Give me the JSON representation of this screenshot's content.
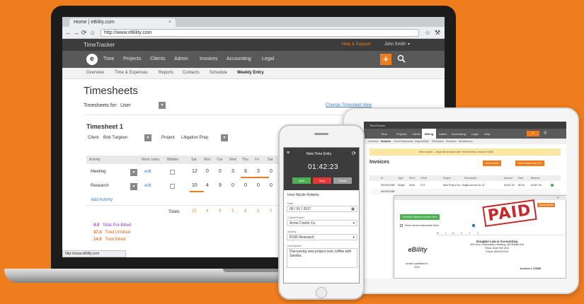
{
  "browser": {
    "tab_title": "Home | eBility.com",
    "url": "http://www.eBility.com",
    "status_url": "http://www.eBility.com"
  },
  "app": {
    "name": "TimeTracker",
    "help_link": "Help & Support",
    "user_name": "John Smith",
    "logo_letter": "e",
    "nav": [
      "Time",
      "Projects",
      "Clients",
      "Admin",
      "Invoices",
      "Accounting",
      "Legal"
    ],
    "subnav": [
      "Overview",
      "Time & Expenses",
      "Reports",
      "Contacts",
      "Schedule",
      "Weekly Entry"
    ],
    "add_icon": "plus-icon",
    "search_icon": "search-icon"
  },
  "timesheets": {
    "page_title": "Timesheets",
    "for_label": "Timesheets for:",
    "for_value": "User",
    "change_link": "Change Timesheet View",
    "sheet_title": "Timesheet 1",
    "client_label": "Client",
    "client_value": "Bob Turgeon",
    "project_label": "Project",
    "project_value": "Litigation Prep",
    "columns": [
      "Activity",
      "",
      "Work notes",
      "Billable",
      "Sat",
      "Mon",
      "Tue",
      "Wed",
      "Thu",
      "Fri",
      "Sat"
    ],
    "rows": [
      {
        "activity": "Meeting",
        "notes": "edit",
        "values": [
          "12",
          "0",
          "0",
          "3",
          "8",
          "3",
          "0"
        ]
      },
      {
        "activity": "Research",
        "notes": "edit",
        "values": [
          "10",
          "4",
          "9",
          "0",
          "0",
          "0",
          "0"
        ]
      }
    ],
    "add_activity": "Add Activity",
    "totals_label": "Totals",
    "totals": [
      "22",
      "4",
      "9",
      "3",
      "8",
      "3",
      "0"
    ],
    "summary": [
      {
        "value": "4.0",
        "label": "Total Pre-Billed",
        "color": "#8b3fc6"
      },
      {
        "value": "37.0",
        "label": "Total Unbilled",
        "color": "#e06a1a"
      },
      {
        "value": "14.0",
        "label": "Total Billed",
        "color": "#e06a1a"
      }
    ]
  },
  "phone": {
    "title": "New Time Entry",
    "timer": "01:42:23",
    "btn_start": "Start",
    "btn_stop": "Stop",
    "btn_pause": "Pause",
    "section": "User Nicole Roberts",
    "date_label": "Date",
    "date_value": "06 / 01 / 2017",
    "client_label": "Client/Project",
    "client_value": "Acme Coolin Co",
    "activity_label": "Activity",
    "activity_value": "R100 Research",
    "desc_label": "Description",
    "desc_value": "Discussing new project over coffee with Sandra."
  },
  "tablet": {
    "app_name": "TimeTracker",
    "nav": [
      "Time",
      "Projects",
      "Clients",
      "Billing",
      "Admin",
      "Accounting",
      "Legal",
      "Help"
    ],
    "active_nav": "Billing",
    "subtabs": [
      "Overview",
      "Invoices",
      "Client Statements",
      "Adjustments",
      "Reminders",
      "Retainers",
      "Remittances"
    ],
    "notice": "New invoice — align bill structure (see Time Entries), Invoice 10080",
    "page_title": "Invoices",
    "btn_add": "Add Invoice",
    "btn_add2": "Add Invoice from List",
    "columns": [
      "Id",
      "Type",
      "Ref #",
      "Client",
      "Project",
      "Description",
      "Amount",
      "Paid",
      "Balance"
    ],
    "rows": [
      {
        "id": "INV0010056",
        "type": "Single",
        "ref": "0026",
        "client": "XYZ",
        "project": "New Project Inc. Single-service for 10",
        "amount": "$1067.00",
        "paid": "$0.00",
        "balance": "$1067.00"
      },
      {
        "id": "INV0010055",
        "type": "",
        "ref": "",
        "client": "",
        "project": "",
        "amount": "",
        "paid": "",
        "balance": ""
      }
    ],
    "modal_button": "Preview Payment Invoice Form",
    "modal_checkbox": "Show Invoice Association Area",
    "stamp": "PAID",
    "company_name": "Douglas Law & Accounting",
    "company_addr1": "900 Floor Embarcadero Building, 450 Market Ave",
    "company_addr2": "Plaza, Suite 900 USA",
    "company_phone": "Phone: 8002331234",
    "company_logo": "eBility",
    "invoice_number": "Invoice # 10080",
    "invoice_to": "Invoice submitted to:",
    "invoice_client": "ACB",
    "modal_close": "Close Modal"
  }
}
